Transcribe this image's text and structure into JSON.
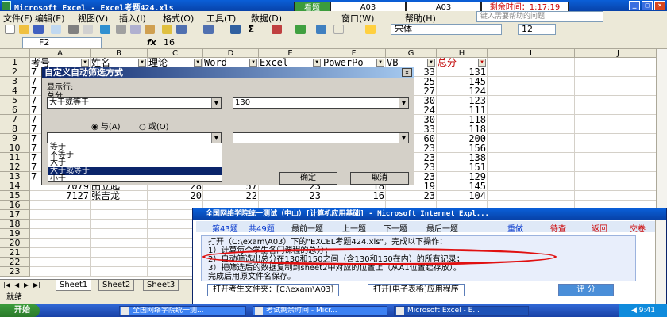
{
  "window": {
    "title": "Microsoft Excel - Excel考题424.xls"
  },
  "exam_bar": {
    "look_label": "看题",
    "q1": "A03",
    "q2": "A03",
    "timer_label": "剩余时间：1:17:19"
  },
  "menu": [
    "文件(F)",
    "编辑(E)",
    "视图(V)",
    "插入(I)",
    "格式(O)",
    "工具(T)",
    "数据(D)",
    "窗口(W)",
    "帮助(H)"
  ],
  "help_placeholder": "键入需要帮助的问题",
  "toolbar": {
    "font": "宋体",
    "size": "12",
    "sigma": "Σ"
  },
  "formula_bar": {
    "name": "F2",
    "fx": "fx",
    "value": "16"
  },
  "columns": [
    "A",
    "B",
    "C",
    "D",
    "E",
    "F",
    "G",
    "H",
    "I",
    "J"
  ],
  "header_row": [
    "考号",
    "姓名",
    "理论",
    "Word",
    "Excel",
    "PowerPo",
    "VB",
    "总分"
  ],
  "rows": [
    {
      "n": "1"
    },
    {
      "n": "2",
      "a": "7",
      "g": "33",
      "h": "131"
    },
    {
      "n": "3",
      "a": "7",
      "g": "25",
      "h": "145"
    },
    {
      "n": "4",
      "a": "7",
      "g": "27",
      "h": "124"
    },
    {
      "n": "5",
      "a": "7",
      "g": "30",
      "h": "123"
    },
    {
      "n": "6",
      "a": "7",
      "g": "24",
      "h": "111"
    },
    {
      "n": "7",
      "a": "7",
      "g": "30",
      "h": "118"
    },
    {
      "n": "8",
      "a": "7",
      "g": "33",
      "h": "118"
    },
    {
      "n": "9",
      "a": "7",
      "g": "60",
      "h": "200"
    },
    {
      "n": "10",
      "a": "7",
      "g": "23",
      "h": "156"
    },
    {
      "n": "11",
      "a": "7",
      "g": "23",
      "h": "138"
    },
    {
      "n": "12",
      "a": "7",
      "g": "23",
      "h": "151"
    },
    {
      "n": "13",
      "a": "7",
      "g": "23",
      "h": "129"
    },
    {
      "n": "14",
      "a": "7079",
      "b": "田立起",
      "c": "28",
      "d": "57",
      "e": "23",
      "f": "18",
      "g": "19",
      "h": "145"
    },
    {
      "n": "15",
      "a": "7127",
      "b": "张吉龙",
      "c": "20",
      "d": "22",
      "e": "23",
      "f": "16",
      "g": "23",
      "h": "104"
    },
    {
      "n": "16"
    },
    {
      "n": "17"
    },
    {
      "n": "18"
    },
    {
      "n": "19"
    },
    {
      "n": "20"
    },
    {
      "n": "21"
    },
    {
      "n": "22"
    },
    {
      "n": "23"
    }
  ],
  "dialog": {
    "title": "自定义自动筛选方式",
    "show_rows": "显示行:",
    "field": "总分",
    "op1": "大于或等于",
    "val1": "130",
    "and_label": "与(A)",
    "or_label": "或(O)",
    "op2": "",
    "val2": "",
    "ok": "确定",
    "cancel": "取消",
    "options": [
      "等于",
      "不等于",
      "大于",
      "大于或等于",
      "小于"
    ]
  },
  "sheet_tabs": [
    "Sheet1",
    "Sheet2",
    "Sheet3"
  ],
  "status": "就绪",
  "ie": {
    "title": "全国网络学院统一测试（中山）[计算机应用基础] - Microsoft Internet Expl...",
    "nav": {
      "q_current": "第43题",
      "q_total": "共49题",
      "first": "最前一题",
      "prev": "上一题",
      "next": "下一题",
      "last": "最后一题",
      "redo": "重做",
      "later": "待查",
      "back": "返回",
      "submit": "交卷"
    },
    "lines": [
      "打开（C:\\exam\\A03）下的\"EXCEL考题424.xls\"，完成以下操作：",
      "1）计算每个学生各门课程的总分；",
      "2）自动筛选出总分在130和150之间（含130和150在内）的所有记录；",
      "3）把筛选后的数据复制到sheet2中对应的位置上（从A1位置起存放）。",
      "完成后用原文件名保存。"
    ],
    "btn_open_folder": "打开考生文件夹：[C:\\exam\\A03]",
    "btn_open_app": "打开[电子表格]应用程序",
    "btn_grade": "评 分"
  },
  "taskbar": {
    "start": "开始",
    "tasks": [
      "全国网络学院统一测...",
      "考试剩余时间 - Micr...",
      "Microsoft Excel - E..."
    ],
    "tray": "◀ 9:41"
  }
}
